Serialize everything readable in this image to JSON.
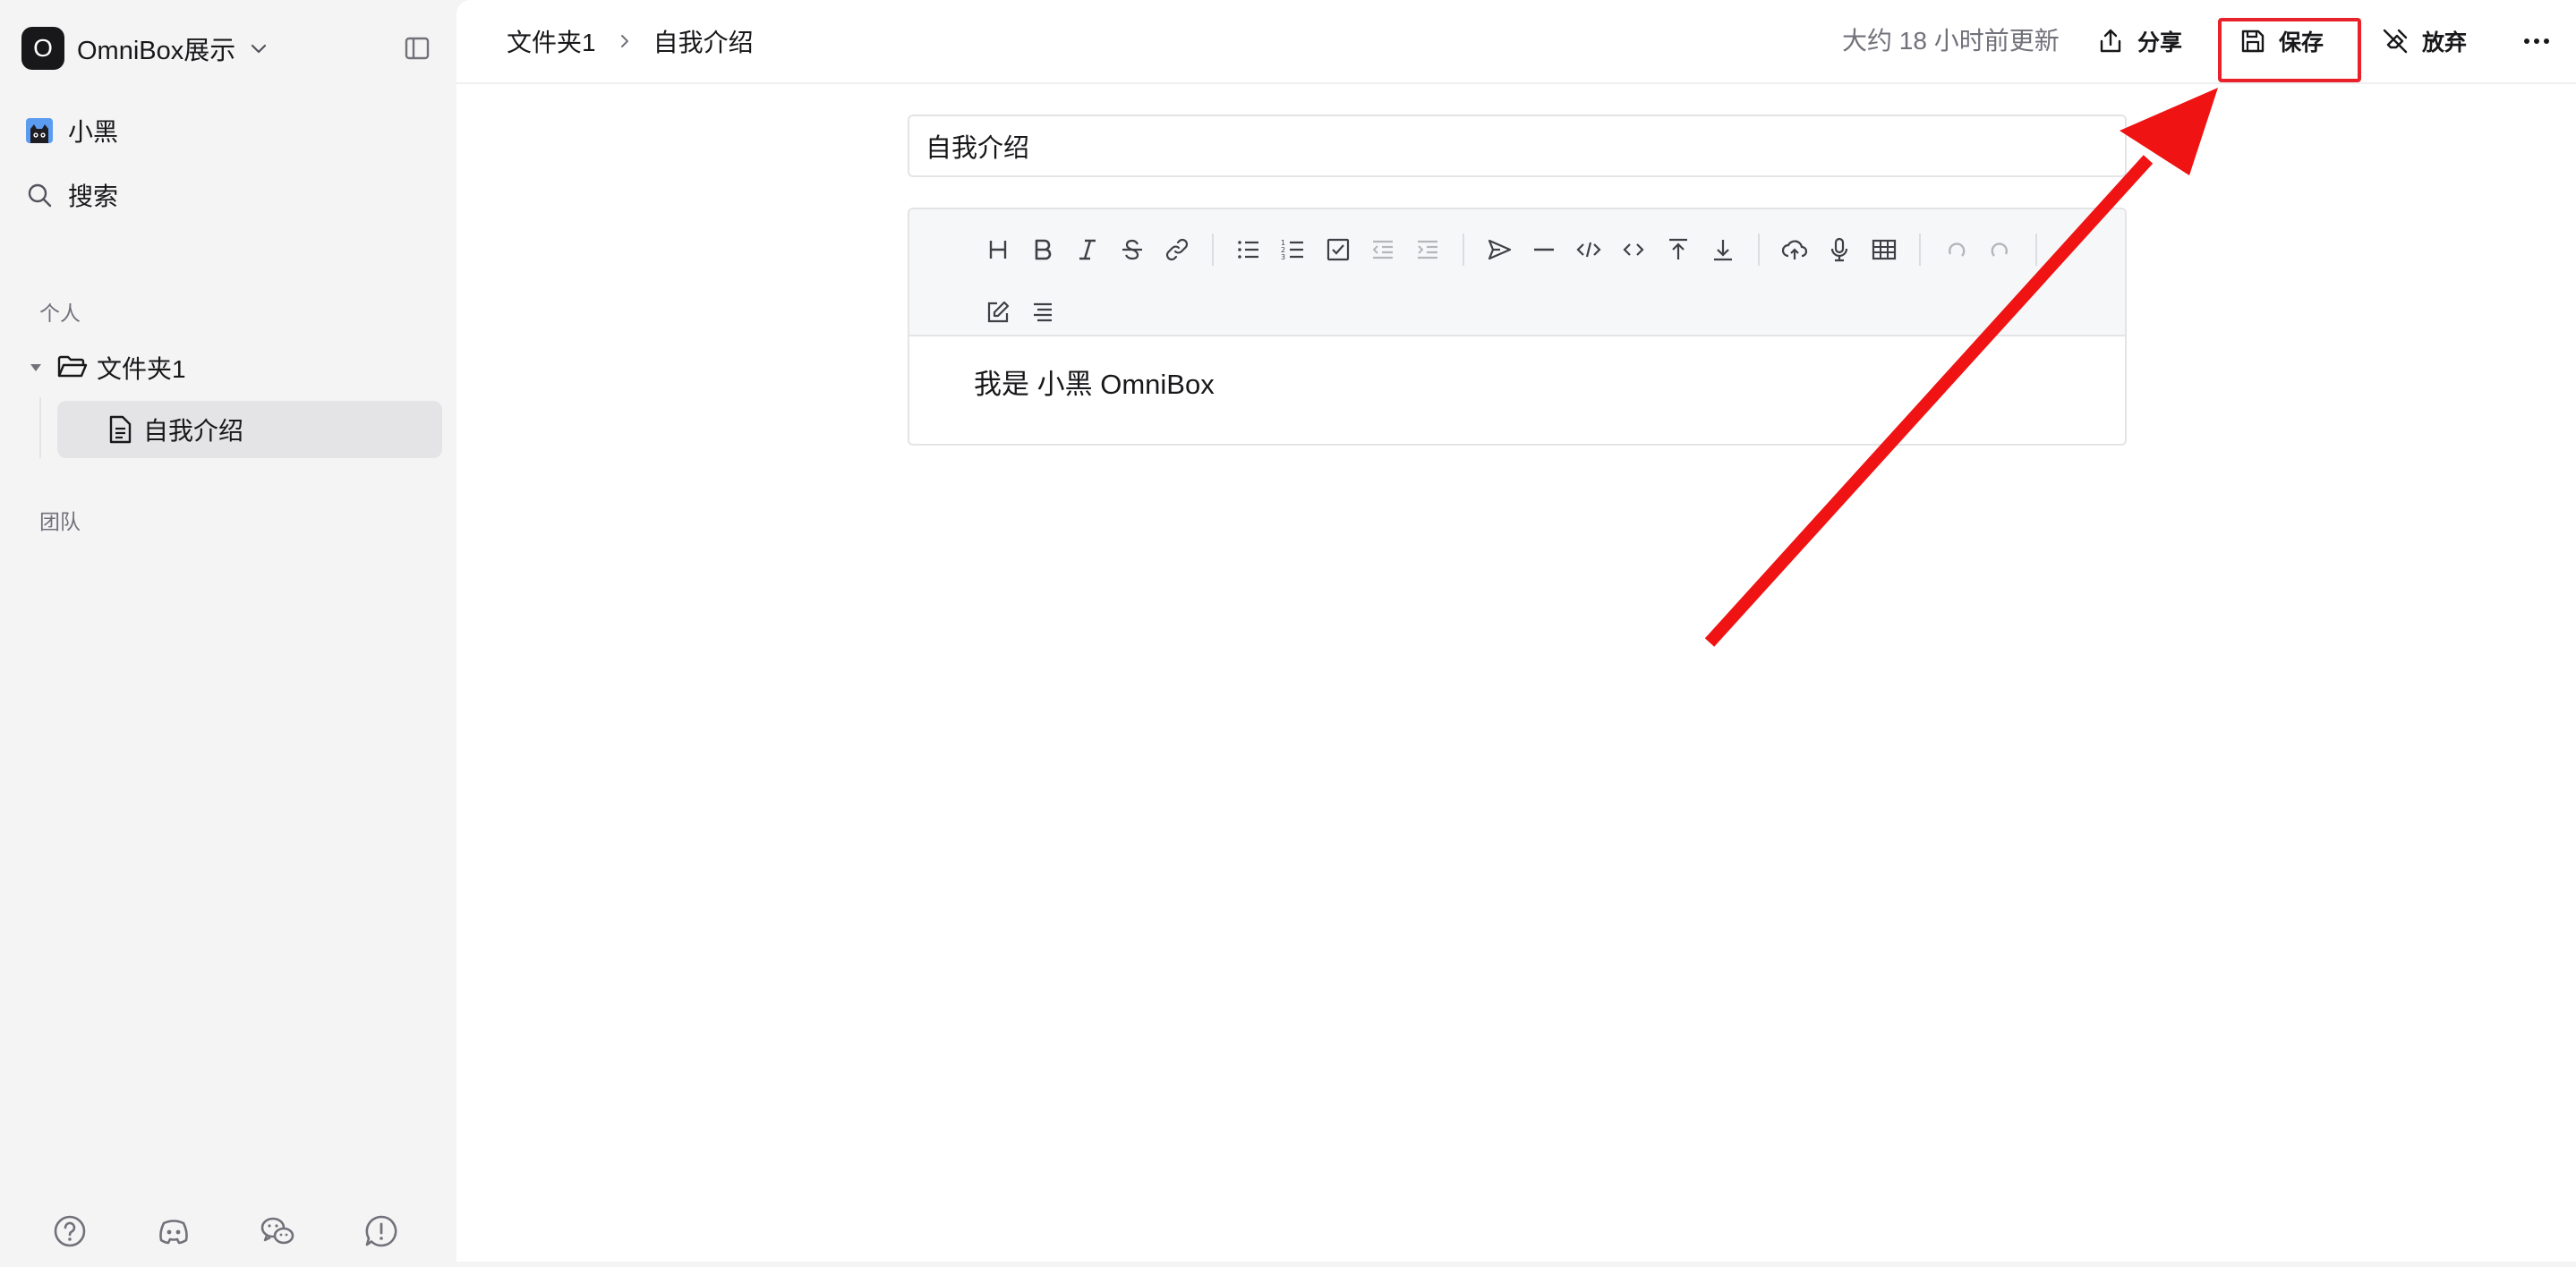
{
  "workspace": {
    "initial": "O",
    "name": "OmniBox展示"
  },
  "sidebar": {
    "user_name": "小黑",
    "search_label": "搜索",
    "section_personal": "个人",
    "section_team": "团队",
    "folder_label": "文件夹1",
    "doc_label": "自我介绍",
    "bottom_icons": [
      "help-icon",
      "discord-icon",
      "wechat-icon",
      "feedback-icon"
    ]
  },
  "header": {
    "breadcrumb": [
      "文件夹1",
      "自我介绍"
    ],
    "updated": "大约 18 小时前更新",
    "share_label": "分享",
    "save_label": "保存",
    "discard_label": "放弃"
  },
  "editor": {
    "title_value": "自我介绍",
    "content": "我是 小黑 OmniBox"
  },
  "colors": {
    "accent": "#18181b",
    "annotation": "#e8212b",
    "sidebar_bg": "#f4f4f5"
  }
}
